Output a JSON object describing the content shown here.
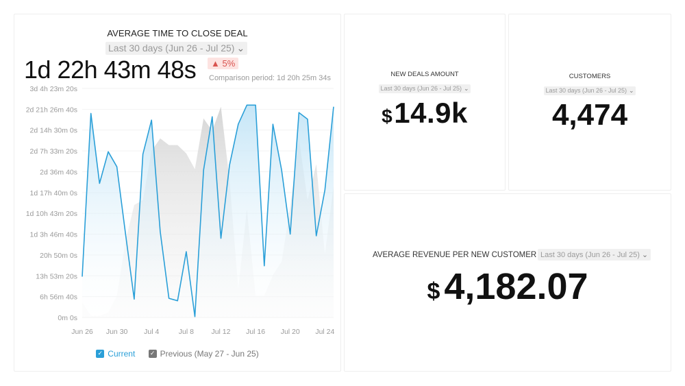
{
  "time_card": {
    "title": "AVERAGE TIME TO CLOSE DEAL",
    "date_range": "Last 30 days (Jun 26 - Jul 25)",
    "value": "1d 22h 43m 48s",
    "delta": "5%",
    "delta_direction": "up",
    "delta_color": "#d9534f",
    "comparison": "Comparison period: 1d 20h 25m 34s"
  },
  "chart_data": {
    "type": "area",
    "title": "AVERAGE TIME TO CLOSE DEAL",
    "xlabel": "",
    "ylabel": "",
    "y_unit": "seconds",
    "ylim": [
      0,
      275000
    ],
    "y_ticks": [
      0,
      25000,
      50000,
      75000,
      100000,
      125000,
      150000,
      175000,
      200000,
      225000,
      250000,
      275000
    ],
    "y_tick_labels": [
      "0m 0s",
      "6h 56m 40s",
      "13h 53m 20s",
      "20h 50m 0s",
      "1d 3h 46m 40s",
      "1d 10h 43m 20s",
      "1d 17h 40m 0s",
      "2d 36m 40s",
      "2d 7h 33m 20s",
      "2d 14h 30m 0s",
      "2d 21h 26m 40s",
      "3d 4h 23m 20s"
    ],
    "x": [
      "Jun 26",
      "Jun 27",
      "Jun 28",
      "Jun 29",
      "Jun 30",
      "Jul 1",
      "Jul 2",
      "Jul 3",
      "Jul 4",
      "Jul 5",
      "Jul 6",
      "Jul 7",
      "Jul 8",
      "Jul 9",
      "Jul 10",
      "Jul 11",
      "Jul 12",
      "Jul 13",
      "Jul 14",
      "Jul 15",
      "Jul 16",
      "Jul 17",
      "Jul 18",
      "Jul 19",
      "Jul 20",
      "Jul 21",
      "Jul 22",
      "Jul 23",
      "Jul 24",
      "Jul 25"
    ],
    "x_tick_labels": [
      "Jun 26",
      "Jun 30",
      "Jul 4",
      "Jul 8",
      "Jul 12",
      "Jul 16",
      "Jul 20",
      "Jul 24"
    ],
    "grid": true,
    "legend": "bottom",
    "series": [
      {
        "name": "Current",
        "color": "#2a9fd8",
        "values": [
          49000,
          245000,
          161000,
          199000,
          181000,
          100000,
          22000,
          196000,
          237000,
          103000,
          23000,
          20000,
          79000,
          1000,
          177000,
          241000,
          95000,
          183000,
          232000,
          255000,
          255000,
          62000,
          232000,
          177000,
          100000,
          246000,
          238000,
          98000,
          153000,
          253000
        ]
      },
      {
        "name": "Previous (May 27 - Jun 25)",
        "color": "#cfcfcf",
        "values": [
          18000,
          2000,
          2000,
          6000,
          26000,
          92000,
          135000,
          141000,
          200000,
          215000,
          207000,
          207000,
          197000,
          178000,
          239000,
          224000,
          253000,
          165000,
          34000,
          130000,
          26000,
          26000,
          51000,
          67000,
          133000,
          215000,
          141000,
          184000,
          76000,
          158000
        ]
      }
    ]
  },
  "legend": {
    "current_label": "Current",
    "previous_label": "Previous (May 27 - Jun 25)"
  },
  "deals_card": {
    "title": "NEW DEALS AMOUNT",
    "date_range": "Last 30 days (Jun 26 - Jul 25)",
    "currency": "$",
    "value": "14.9k"
  },
  "customers_card": {
    "title": "CUSTOMERS",
    "date_range": "Last 30 days (Jun 26 - Jul 25)",
    "value": "4,474"
  },
  "arpu_card": {
    "title": "AVERAGE REVENUE PER NEW CUSTOMER",
    "date_range": "Last 30 days (Jun 26 - Jul 25)",
    "currency": "$",
    "value": "4,182.07"
  }
}
